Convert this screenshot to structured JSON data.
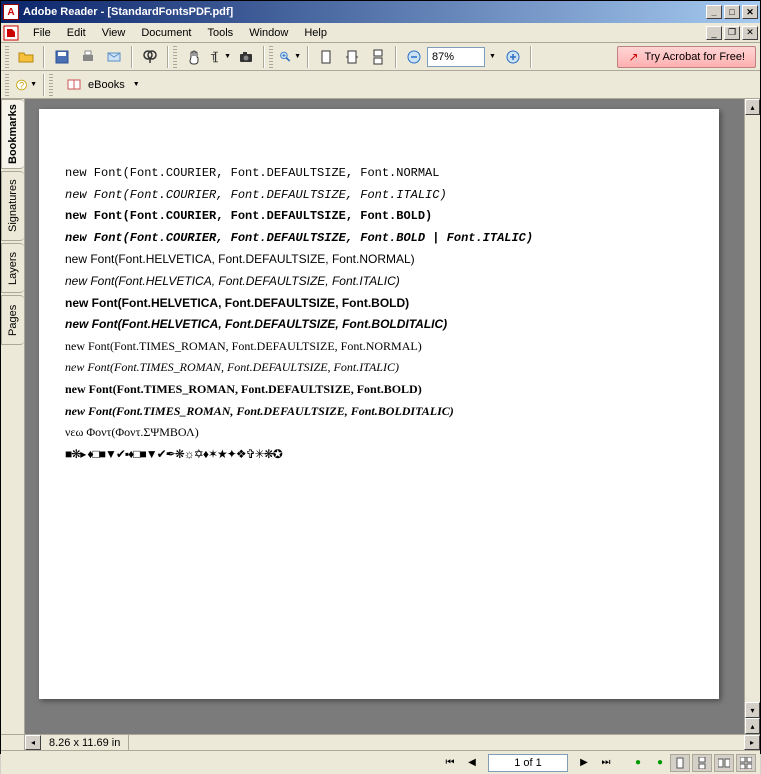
{
  "window": {
    "title": "Adobe Reader - [StandardFontsPDF.pdf]"
  },
  "menu": {
    "file": "File",
    "edit": "Edit",
    "view": "View",
    "document": "Document",
    "tools": "Tools",
    "window": "Window",
    "help": "Help"
  },
  "toolbar": {
    "zoom_value": "87%",
    "promo_text": "Try Acrobat for Free!",
    "ebooks_label": "eBooks"
  },
  "side_tabs": {
    "bookmarks": "Bookmarks",
    "signatures": "Signatures",
    "layers": "Layers",
    "pages": "Pages"
  },
  "document_lines": [
    {
      "text": "new Font(Font.COURIER, Font.DEFAULTSIZE, Font.NORMAL",
      "style": "font-family:'Courier New',monospace;"
    },
    {
      "text": "new Font(Font.COURIER, Font.DEFAULTSIZE, Font.ITALIC)",
      "style": "font-family:'Courier New',monospace; font-style:italic;"
    },
    {
      "text": "new Font(Font.COURIER, Font.DEFAULTSIZE, Font.BOLD)",
      "style": "font-family:'Courier New',monospace; font-weight:bold;"
    },
    {
      "text": "new Font(Font.COURIER, Font.DEFAULTSIZE, Font.BOLD | Font.ITALIC)",
      "style": "font-family:'Courier New',monospace; font-weight:bold; font-style:italic;"
    },
    {
      "text": "new Font(Font.HELVETICA, Font.DEFAULTSIZE, Font.NORMAL)",
      "style": "font-family:Arial,Helvetica,sans-serif;"
    },
    {
      "text": "new Font(Font.HELVETICA, Font.DEFAULTSIZE, Font.ITALIC)",
      "style": "font-family:Arial,Helvetica,sans-serif; font-style:italic;"
    },
    {
      "text": "new Font(Font.HELVETICA, Font.DEFAULTSIZE, Font.BOLD)",
      "style": "font-family:Arial,Helvetica,sans-serif; font-weight:bold;"
    },
    {
      "text": "new Font(Font.HELVETICA, Font.DEFAULTSIZE, Font.BOLDITALIC)",
      "style": "font-family:Arial,Helvetica,sans-serif; font-weight:bold; font-style:italic;"
    },
    {
      "text": "new Font(Font.TIMES_ROMAN, Font.DEFAULTSIZE, Font.NORMAL)",
      "style": "font-family:'Times New Roman',serif;"
    },
    {
      "text": "new Font(Font.TIMES_ROMAN, Font.DEFAULTSIZE, Font.ITALIC)",
      "style": "font-family:'Times New Roman',serif; font-style:italic;"
    },
    {
      "text": "new Font(Font.TIMES_ROMAN, Font.DEFAULTSIZE, Font.BOLD)",
      "style": "font-family:'Times New Roman',serif; font-weight:bold;"
    },
    {
      "text": "new Font(Font.TIMES_ROMAN, Font.DEFAULTSIZE, Font.BOLDITALIC)",
      "style": "font-family:'Times New Roman',serif; font-weight:bold; font-style:italic;"
    },
    {
      "text": "νεω Φοντ(Φοντ.ΣΨΜΒΟΛ)",
      "style": "font-family:'Times New Roman',serif;"
    },
    {
      "text": "■❋▸ ♦□■▼✔▪♦□■▼✔✒❋☼✡♦✶★✦❖✞✳❋✪",
      "style": "font-family:serif; letter-spacing:-1px;"
    }
  ],
  "status": {
    "page_dimensions": "8.26 x 11.69 in",
    "page_indicator": "1 of 1"
  }
}
